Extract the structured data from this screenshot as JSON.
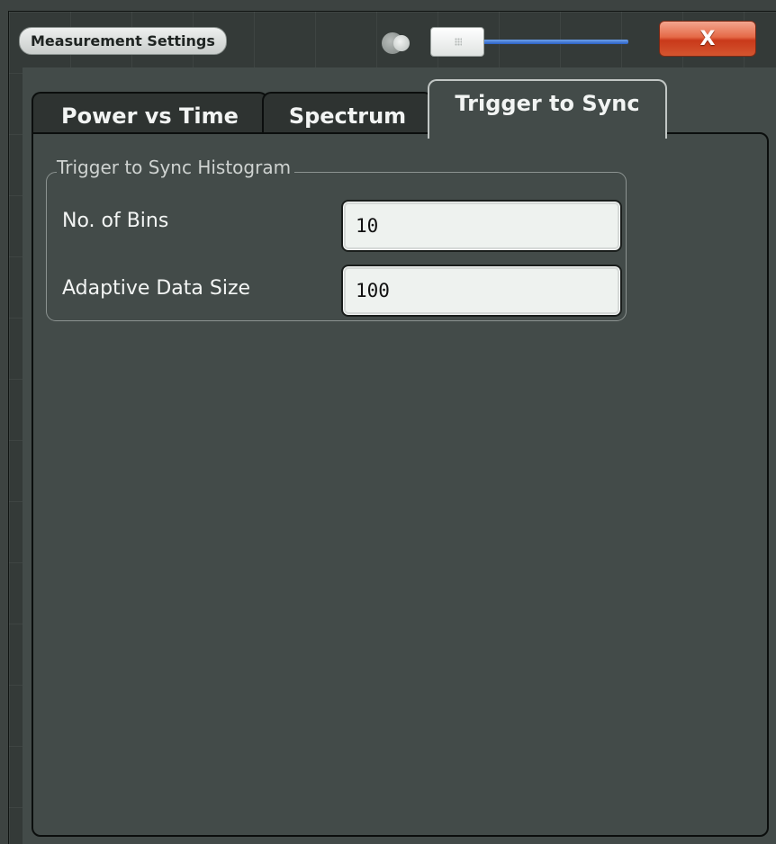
{
  "window": {
    "title": "Measurement Settings",
    "close_label": "X"
  },
  "tabs": [
    {
      "label": "Power vs Time",
      "active": false
    },
    {
      "label": "Spectrum",
      "active": false
    },
    {
      "label": "Trigger to Sync",
      "active": true
    }
  ],
  "group": {
    "title": "Trigger to Sync Histogram",
    "fields": [
      {
        "label": "No. of Bins",
        "value": "10"
      },
      {
        "label": "Adaptive Data Size",
        "value": "100"
      }
    ]
  },
  "colors": {
    "close_button": "#d9502c",
    "slider_track": "#2b61c4",
    "panel_background": "#434b49"
  },
  "icons": {
    "transparency_icon": "overlapping-circles-icon",
    "slider_grip": "grip-dots-icon"
  }
}
